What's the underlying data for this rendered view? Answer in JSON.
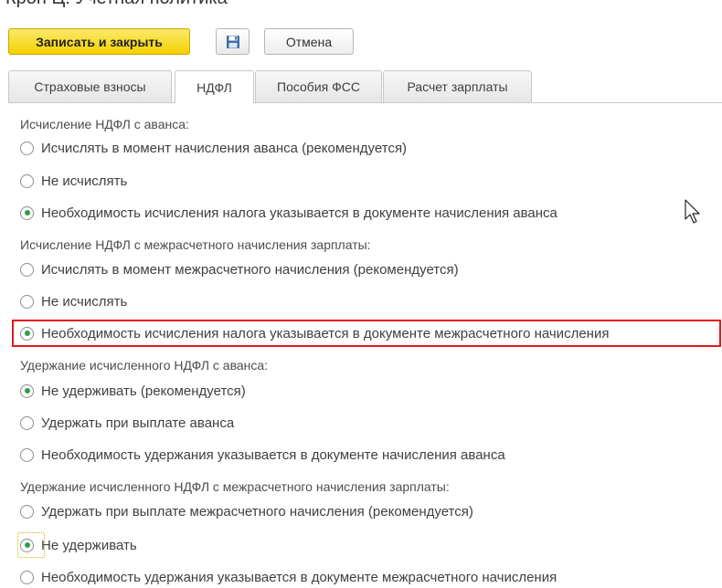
{
  "window": {
    "title": "Крон Ц: Учетная политика"
  },
  "toolbar": {
    "save_close_label": "Записать и закрыть",
    "cancel_label": "Отмена",
    "accent_color": "#f4d100"
  },
  "tabs": [
    {
      "label": "Страховые взносы",
      "active": false
    },
    {
      "label": "НДФЛ",
      "active": true
    },
    {
      "label": "Пособия ФСС",
      "active": false
    },
    {
      "label": "Расчет зарплаты",
      "active": false
    }
  ],
  "groups": [
    {
      "title": "Исчисление НДФЛ с аванса:",
      "options": [
        {
          "label": "Исчислять в момент начисления аванса (рекомендуется)",
          "checked": false
        },
        {
          "label": "Не исчислять",
          "checked": false
        },
        {
          "label": "Необходимость исчисления налога указывается в документе начисления аванса",
          "checked": true
        }
      ]
    },
    {
      "title": "Исчисление НДФЛ с межрасчетного начисления зарплаты:",
      "options": [
        {
          "label": "Исчислять в момент межрасчетного начисления (рекомендуется)",
          "checked": false
        },
        {
          "label": "Не исчислять",
          "checked": false
        },
        {
          "label": "Необходимость исчисления налога указывается в документе межрасчетного начисления",
          "checked": true
        }
      ]
    },
    {
      "title": "Удержание исчисленного НДФЛ с аванса:",
      "options": [
        {
          "label": "Не удерживать (рекомендуется)",
          "checked": true
        },
        {
          "label": "Удержать при выплате аванса",
          "checked": false
        },
        {
          "label": "Необходимость удержания указывается в документе начисления аванса",
          "checked": false
        }
      ]
    },
    {
      "title": "Удержание исчисленного НДФЛ с межрасчетного начисления зарплаты:",
      "options": [
        {
          "label": "Удержать при выплате межрасчетного начисления (рекомендуется)",
          "checked": false
        },
        {
          "label": "Не удерживать",
          "checked": true
        },
        {
          "label": "Необходимость удержания указывается в документе межрасчетного начисления",
          "checked": false
        }
      ]
    }
  ],
  "colors": {
    "highlight": "#e8141b",
    "radio_selected": "#2e9e4a"
  },
  "icons": {
    "save": "floppy-disk-icon",
    "cursor": "mouse-pointer-icon"
  }
}
